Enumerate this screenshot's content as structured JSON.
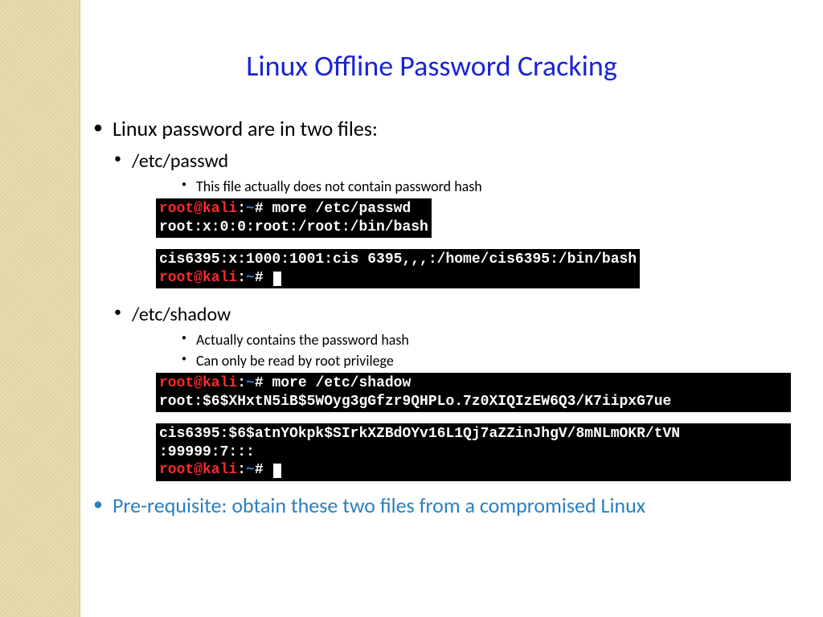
{
  "title": "Linux Offline Password Cracking",
  "intro": "Linux password are in two files:",
  "passwd": {
    "label": "/etc/passwd",
    "note": "This file actually does not contain password hash"
  },
  "shadow": {
    "label": "/etc/shadow",
    "note1": "Actually contains the password hash",
    "note2": "Can only be read by root privilege"
  },
  "prereq": "Pre-requisite: obtain these two files from a compromised Linux",
  "prompt": {
    "user": "root@kali",
    "sep": ":",
    "path": "~",
    "hash": "# "
  },
  "cmd": {
    "more_passwd": "more /etc/passwd",
    "more_shadow": "more /etc/shadow"
  },
  "out": {
    "passwd_root": "root:x:0:0:root:/root:/bin/bash",
    "passwd_cis": "cis6395:x:1000:1001:cis 6395,,,:/home/cis6395:/bin/bash",
    "shadow_root": "root:$6$XHxtN5iB$5WOyg3gGfzr9QHPLo.7z0XIQIzEW6Q3/K7iipxG7ue",
    "shadow_cis_l1": "cis6395:$6$atnYOkpk$SIrkXZBdOYv16L1Qj7aZZinJhgV/8mNLmOKR/tVN",
    "shadow_cis_l2": ":99999:7:::"
  }
}
